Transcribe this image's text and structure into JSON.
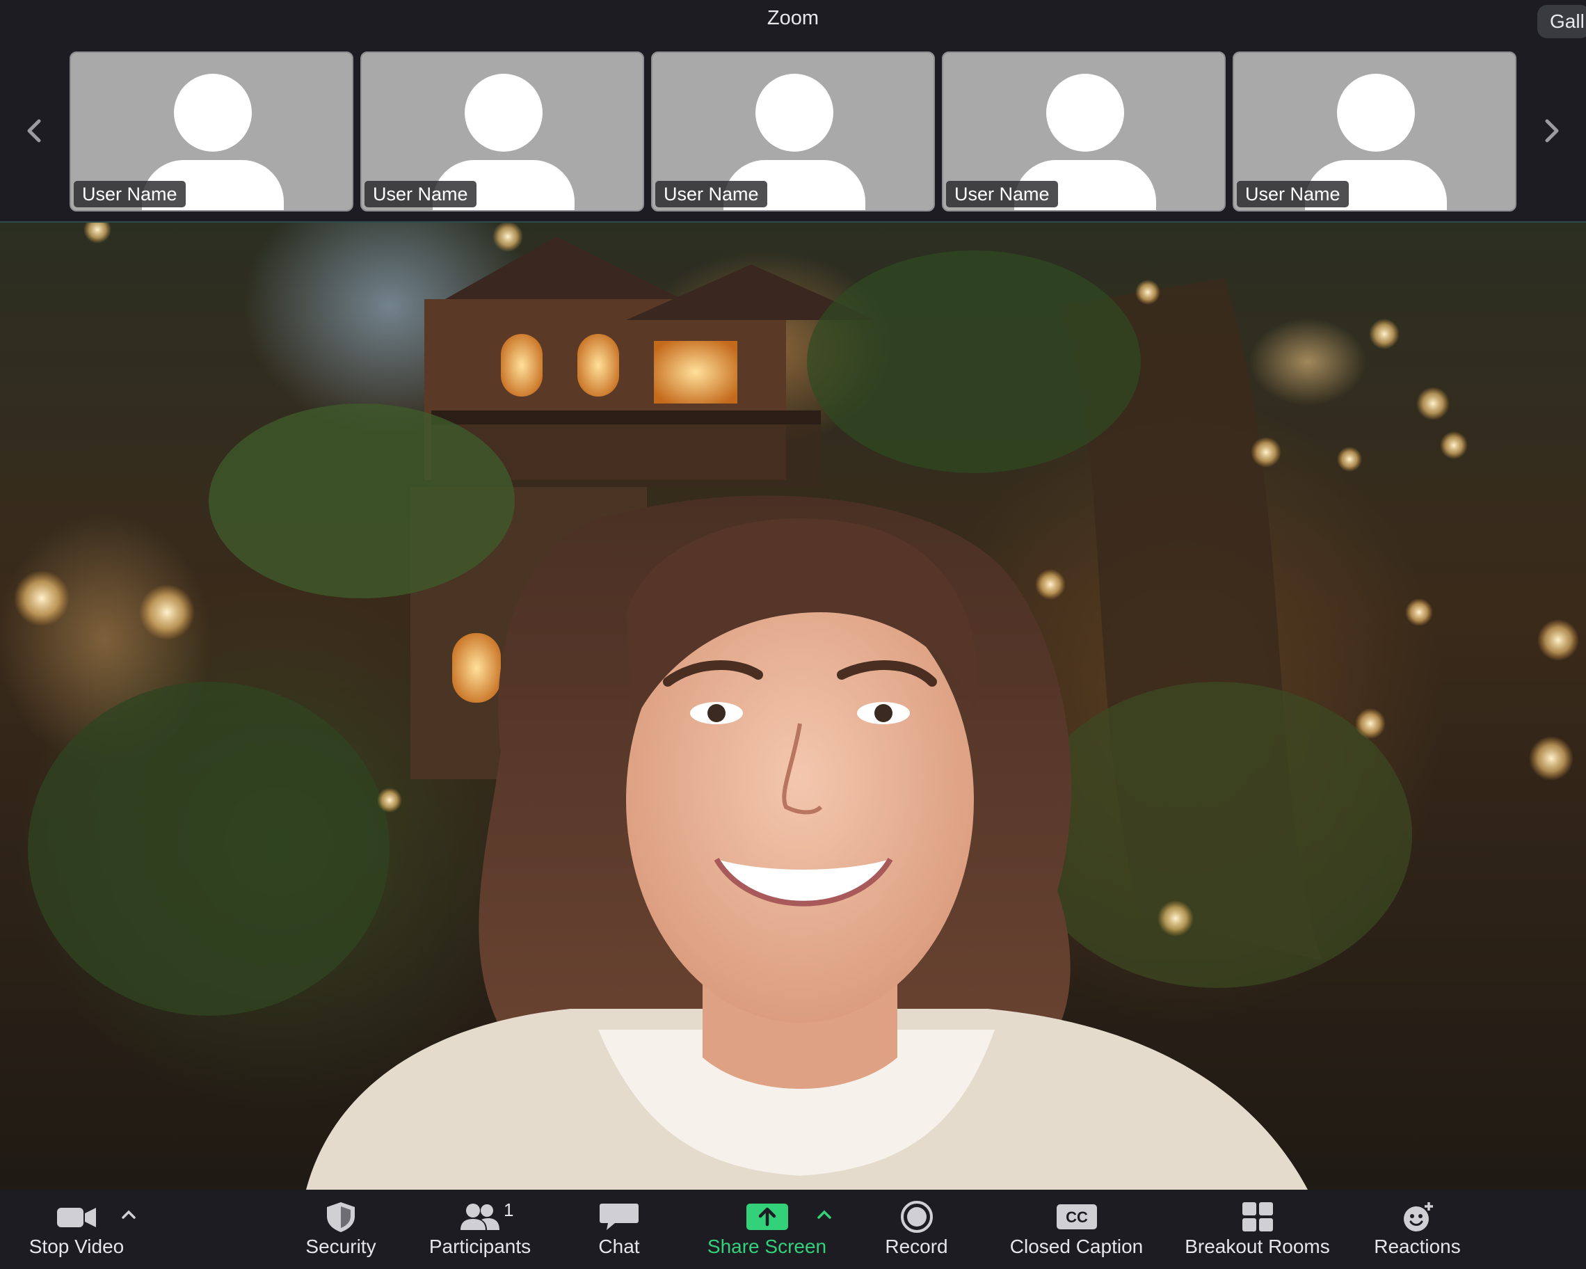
{
  "window": {
    "title": "Zoom",
    "view_button_label": "Gall"
  },
  "participants_strip": {
    "tiles": [
      {
        "name": "User Name"
      },
      {
        "name": "User Name"
      },
      {
        "name": "User Name"
      },
      {
        "name": "User Name"
      },
      {
        "name": "User Name"
      }
    ]
  },
  "toolbar": {
    "stop_video": "Stop Video",
    "security": "Security",
    "participants": "Participants",
    "participants_count": "1",
    "chat": "Chat",
    "share_screen": "Share Screen",
    "record": "Record",
    "closed_caption": "Closed Caption",
    "closed_caption_icon_text": "CC",
    "breakout_rooms": "Breakout Rooms",
    "reactions": "Reactions"
  },
  "colors": {
    "background": "#1c1c22",
    "tile": "#a9a9a9",
    "share_accent": "#33d17a"
  },
  "icons": [
    "chevron-left-icon",
    "chevron-right-icon",
    "video-camera-icon",
    "shield-icon",
    "participants-icon",
    "chat-bubble-icon",
    "share-arrow-icon",
    "record-icon",
    "cc-icon",
    "grid-icon",
    "emoji-plus-icon"
  ]
}
